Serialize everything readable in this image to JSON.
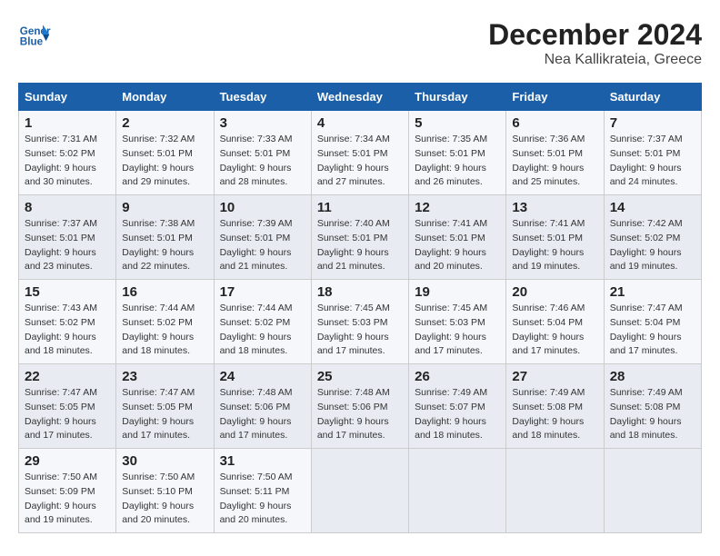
{
  "logo": {
    "line1": "General",
    "line2": "Blue"
  },
  "title": "December 2024",
  "subtitle": "Nea Kallikrateia, Greece",
  "weekdays": [
    "Sunday",
    "Monday",
    "Tuesday",
    "Wednesday",
    "Thursday",
    "Friday",
    "Saturday"
  ],
  "weeks": [
    [
      {
        "day": "1",
        "sunrise": "7:31 AM",
        "sunset": "5:02 PM",
        "daylight": "9 hours and 30 minutes."
      },
      {
        "day": "2",
        "sunrise": "7:32 AM",
        "sunset": "5:01 PM",
        "daylight": "9 hours and 29 minutes."
      },
      {
        "day": "3",
        "sunrise": "7:33 AM",
        "sunset": "5:01 PM",
        "daylight": "9 hours and 28 minutes."
      },
      {
        "day": "4",
        "sunrise": "7:34 AM",
        "sunset": "5:01 PM",
        "daylight": "9 hours and 27 minutes."
      },
      {
        "day": "5",
        "sunrise": "7:35 AM",
        "sunset": "5:01 PM",
        "daylight": "9 hours and 26 minutes."
      },
      {
        "day": "6",
        "sunrise": "7:36 AM",
        "sunset": "5:01 PM",
        "daylight": "9 hours and 25 minutes."
      },
      {
        "day": "7",
        "sunrise": "7:37 AM",
        "sunset": "5:01 PM",
        "daylight": "9 hours and 24 minutes."
      }
    ],
    [
      {
        "day": "8",
        "sunrise": "7:37 AM",
        "sunset": "5:01 PM",
        "daylight": "9 hours and 23 minutes."
      },
      {
        "day": "9",
        "sunrise": "7:38 AM",
        "sunset": "5:01 PM",
        "daylight": "9 hours and 22 minutes."
      },
      {
        "day": "10",
        "sunrise": "7:39 AM",
        "sunset": "5:01 PM",
        "daylight": "9 hours and 21 minutes."
      },
      {
        "day": "11",
        "sunrise": "7:40 AM",
        "sunset": "5:01 PM",
        "daylight": "9 hours and 21 minutes."
      },
      {
        "day": "12",
        "sunrise": "7:41 AM",
        "sunset": "5:01 PM",
        "daylight": "9 hours and 20 minutes."
      },
      {
        "day": "13",
        "sunrise": "7:41 AM",
        "sunset": "5:01 PM",
        "daylight": "9 hours and 19 minutes."
      },
      {
        "day": "14",
        "sunrise": "7:42 AM",
        "sunset": "5:02 PM",
        "daylight": "9 hours and 19 minutes."
      }
    ],
    [
      {
        "day": "15",
        "sunrise": "7:43 AM",
        "sunset": "5:02 PM",
        "daylight": "9 hours and 18 minutes."
      },
      {
        "day": "16",
        "sunrise": "7:44 AM",
        "sunset": "5:02 PM",
        "daylight": "9 hours and 18 minutes."
      },
      {
        "day": "17",
        "sunrise": "7:44 AM",
        "sunset": "5:02 PM",
        "daylight": "9 hours and 18 minutes."
      },
      {
        "day": "18",
        "sunrise": "7:45 AM",
        "sunset": "5:03 PM",
        "daylight": "9 hours and 17 minutes."
      },
      {
        "day": "19",
        "sunrise": "7:45 AM",
        "sunset": "5:03 PM",
        "daylight": "9 hours and 17 minutes."
      },
      {
        "day": "20",
        "sunrise": "7:46 AM",
        "sunset": "5:04 PM",
        "daylight": "9 hours and 17 minutes."
      },
      {
        "day": "21",
        "sunrise": "7:47 AM",
        "sunset": "5:04 PM",
        "daylight": "9 hours and 17 minutes."
      }
    ],
    [
      {
        "day": "22",
        "sunrise": "7:47 AM",
        "sunset": "5:05 PM",
        "daylight": "9 hours and 17 minutes."
      },
      {
        "day": "23",
        "sunrise": "7:47 AM",
        "sunset": "5:05 PM",
        "daylight": "9 hours and 17 minutes."
      },
      {
        "day": "24",
        "sunrise": "7:48 AM",
        "sunset": "5:06 PM",
        "daylight": "9 hours and 17 minutes."
      },
      {
        "day": "25",
        "sunrise": "7:48 AM",
        "sunset": "5:06 PM",
        "daylight": "9 hours and 17 minutes."
      },
      {
        "day": "26",
        "sunrise": "7:49 AM",
        "sunset": "5:07 PM",
        "daylight": "9 hours and 18 minutes."
      },
      {
        "day": "27",
        "sunrise": "7:49 AM",
        "sunset": "5:08 PM",
        "daylight": "9 hours and 18 minutes."
      },
      {
        "day": "28",
        "sunrise": "7:49 AM",
        "sunset": "5:08 PM",
        "daylight": "9 hours and 18 minutes."
      }
    ],
    [
      {
        "day": "29",
        "sunrise": "7:50 AM",
        "sunset": "5:09 PM",
        "daylight": "9 hours and 19 minutes."
      },
      {
        "day": "30",
        "sunrise": "7:50 AM",
        "sunset": "5:10 PM",
        "daylight": "9 hours and 20 minutes."
      },
      {
        "day": "31",
        "sunrise": "7:50 AM",
        "sunset": "5:11 PM",
        "daylight": "9 hours and 20 minutes."
      },
      null,
      null,
      null,
      null
    ]
  ]
}
